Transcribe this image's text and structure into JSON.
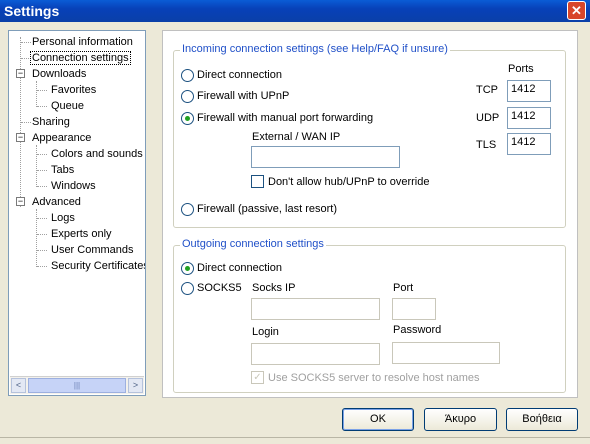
{
  "window": {
    "title": "Settings"
  },
  "tree": {
    "items": [
      {
        "label": "Personal information"
      },
      {
        "label": "Connection settings"
      },
      {
        "label": "Downloads",
        "expander": "−"
      },
      {
        "label": "Favorites"
      },
      {
        "label": "Queue"
      },
      {
        "label": "Sharing"
      },
      {
        "label": "Appearance",
        "expander": "−"
      },
      {
        "label": "Colors and sounds"
      },
      {
        "label": "Tabs"
      },
      {
        "label": "Windows"
      },
      {
        "label": "Advanced",
        "expander": "−"
      },
      {
        "label": "Logs"
      },
      {
        "label": "Experts only"
      },
      {
        "label": "User Commands"
      },
      {
        "label": "Security Certificates"
      }
    ],
    "scroll_left": "<",
    "scroll_thumb": "|||",
    "scroll_right": ">"
  },
  "incoming": {
    "group_title": "Incoming connection settings (see Help/FAQ if unsure)",
    "direct_label": "Direct connection",
    "upnp_label": "Firewall with UPnP",
    "manual_label": "Firewall with manual port forwarding",
    "wan_ip_label": "External / WAN IP",
    "wan_ip_value": "",
    "override_label": "Don't allow hub/UPnP to override",
    "passive_label": "Firewall (passive, last resort)",
    "ports_label": "Ports",
    "tcp_label": "TCP",
    "tcp_value": "1412",
    "udp_label": "UDP",
    "udp_value": "1412",
    "tls_label": "TLS",
    "tls_value": "1412",
    "selected": "manual"
  },
  "outgoing": {
    "group_title": "Outgoing connection settings",
    "direct_label": "Direct connection",
    "socks_label": "SOCKS5",
    "socks_ip_label": "Socks IP",
    "socks_ip_value": "",
    "port_label": "Port",
    "port_value": "",
    "login_label": "Login",
    "login_value": "",
    "password_label": "Password",
    "password_value": "",
    "resolve_label": "Use SOCKS5 server to resolve host names",
    "selected": "direct"
  },
  "buttons": {
    "ok": "OK",
    "cancel": "Άκυρο",
    "help": "Βοήθεια"
  },
  "icons": {
    "close": "close-icon",
    "expander": "minus-box-icon",
    "checkmark": "checkmark-icon"
  },
  "colors": {
    "titlebar": "#0a4fc6",
    "group_title": "#2050c8",
    "radio_dot": "#21a121",
    "close_button": "#d8462a"
  }
}
